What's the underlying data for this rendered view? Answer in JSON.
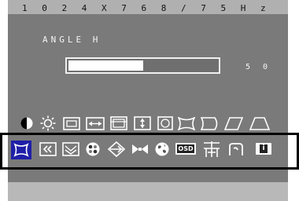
{
  "osd": {
    "mode_text": "1 0 2 4 X 7 6 8 / 7 5 H z",
    "parameter": {
      "label": "ANGLE H",
      "value": "5 0",
      "level_fraction": 0.5
    },
    "row1_icons": [
      "contrast-icon",
      "brightness-icon",
      "h-size-icon",
      "h-position-icon",
      "v-size-icon",
      "v-position-icon",
      "tilt-icon",
      "pincushion-icon",
      "pin-balance-icon",
      "parallelogram-icon",
      "trapezoid-icon"
    ],
    "row2_icons": [
      "angle-h-icon",
      "recall-icon",
      "degauss-icon",
      "color-icon",
      "moire-icon",
      "convergence-icon",
      "language-icon",
      "osd-icon",
      "position-icon",
      "input-icon",
      "info-icon"
    ],
    "selected_row": 2,
    "selected_index": 0,
    "osd_badge": "OSD",
    "info_badge": "i",
    "colors": {
      "panel": "#7a7a7a",
      "topbar": "#b0b0b0",
      "bar": "#ffffff",
      "selection": "#000000"
    }
  }
}
